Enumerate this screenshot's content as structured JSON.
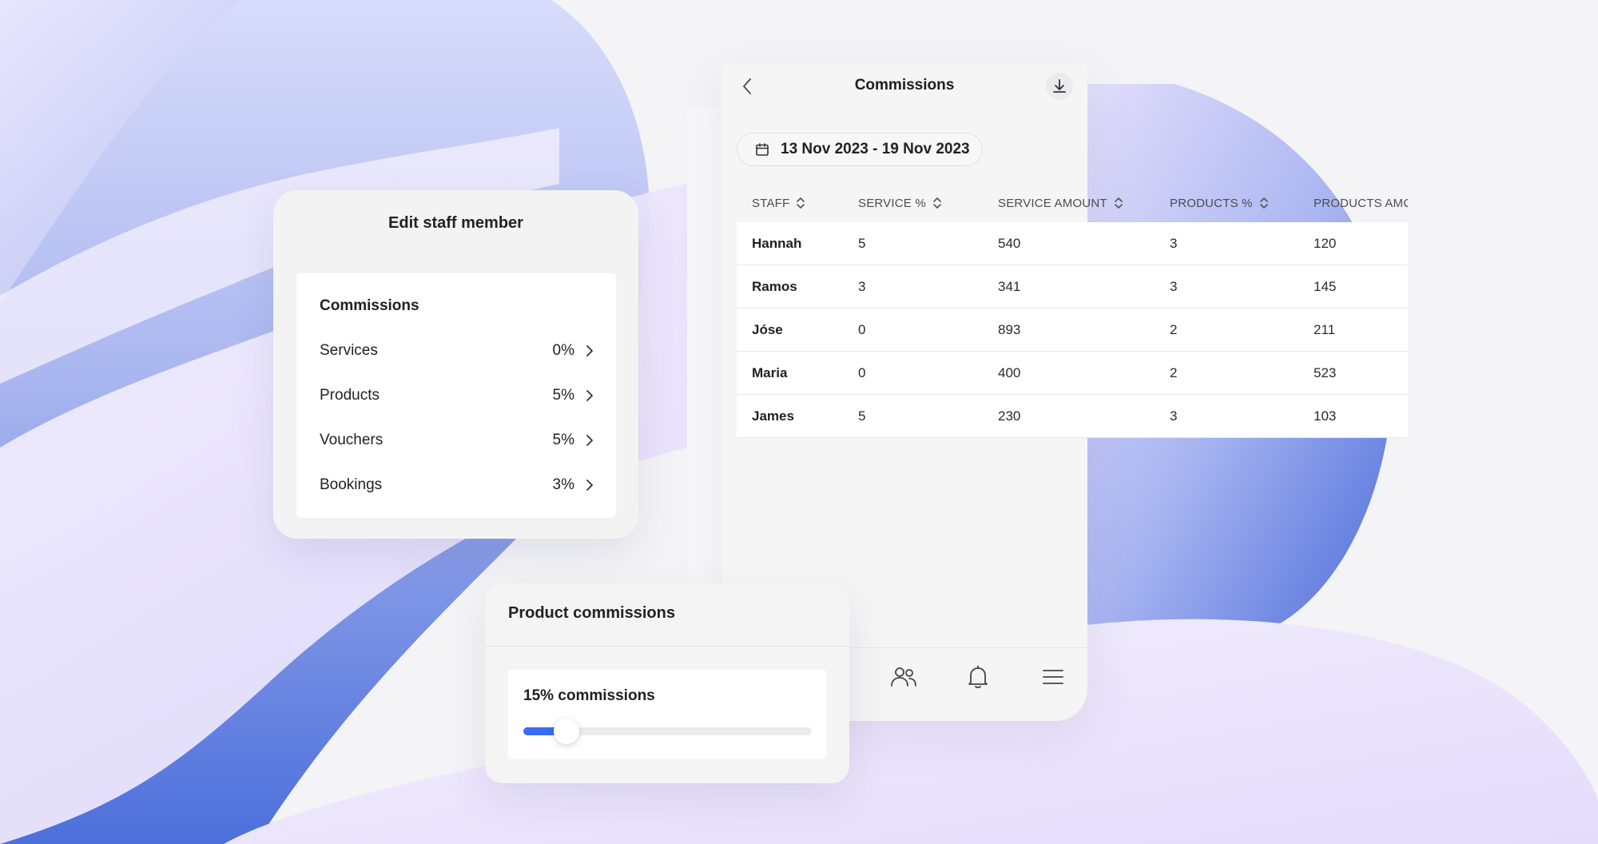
{
  "colors": {
    "accent": "#3b6cf0",
    "background_blob_blue": "#4f72dc",
    "background_blob_lilac": "#e9e2fb"
  },
  "phone": {
    "title": "Commissions",
    "date_range": "13 Nov 2023 - 19 Nov 2023",
    "icons": {
      "back": "chevron-left-icon",
      "download": "download-icon",
      "calendar": "calendar-icon"
    },
    "tabbar": [
      "users-icon",
      "bell-icon",
      "menu-icon"
    ]
  },
  "table": {
    "headers": [
      "STAFF",
      "SERVICE %",
      "SERVICE AMOUNT",
      "PRODUCTS %",
      "PRODUCTS AMC"
    ],
    "rows": [
      [
        "Hannah",
        "5",
        "540",
        "3",
        "120"
      ],
      [
        "Ramos",
        "3",
        "341",
        "3",
        "145"
      ],
      [
        "Jóse",
        "0",
        "893",
        "2",
        "211"
      ],
      [
        "Maria",
        "0",
        "400",
        "2",
        "523"
      ],
      [
        "James",
        "5",
        "230",
        "3",
        "103"
      ]
    ]
  },
  "edit_staff": {
    "title": "Edit staff member",
    "section_title": "Commissions",
    "items": [
      {
        "label": "Services",
        "value": "0%"
      },
      {
        "label": "Products",
        "value": "5%"
      },
      {
        "label": "Vouchers",
        "value": "5%"
      },
      {
        "label": "Bookings",
        "value": "3%"
      }
    ]
  },
  "product_commissions": {
    "title": "Product commissions",
    "slider_label": "15% commissions",
    "slider_fraction": 0.15
  }
}
